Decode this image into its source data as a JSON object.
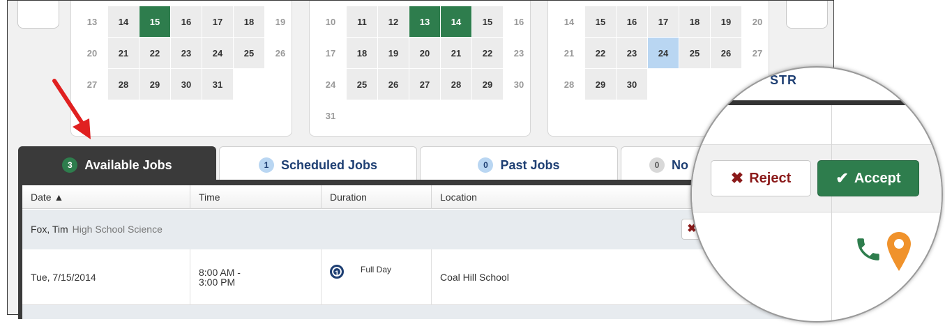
{
  "calendars": [
    {
      "rows": [
        [
          {
            "d": "13",
            "s": "muted"
          },
          {
            "d": "14",
            "s": "avail"
          },
          {
            "d": "15",
            "s": "job"
          },
          {
            "d": "16",
            "s": "avail"
          },
          {
            "d": "17",
            "s": "avail"
          },
          {
            "d": "18",
            "s": "avail"
          },
          {
            "d": "19",
            "s": "muted"
          }
        ],
        [
          {
            "d": "20",
            "s": "muted"
          },
          {
            "d": "21",
            "s": "avail"
          },
          {
            "d": "22",
            "s": "avail"
          },
          {
            "d": "23",
            "s": "avail"
          },
          {
            "d": "24",
            "s": "avail"
          },
          {
            "d": "25",
            "s": "avail"
          },
          {
            "d": "26",
            "s": "muted"
          }
        ],
        [
          {
            "d": "27",
            "s": "muted"
          },
          {
            "d": "28",
            "s": "avail"
          },
          {
            "d": "29",
            "s": "avail"
          },
          {
            "d": "30",
            "s": "avail"
          },
          {
            "d": "31",
            "s": "avail"
          }
        ]
      ]
    },
    {
      "rows": [
        [
          {
            "d": "10",
            "s": "muted"
          },
          {
            "d": "11",
            "s": "avail"
          },
          {
            "d": "12",
            "s": "avail"
          },
          {
            "d": "13",
            "s": "job"
          },
          {
            "d": "14",
            "s": "job"
          },
          {
            "d": "15",
            "s": "avail"
          },
          {
            "d": "16",
            "s": "muted"
          }
        ],
        [
          {
            "d": "17",
            "s": "muted"
          },
          {
            "d": "18",
            "s": "avail"
          },
          {
            "d": "19",
            "s": "avail"
          },
          {
            "d": "20",
            "s": "avail"
          },
          {
            "d": "21",
            "s": "avail"
          },
          {
            "d": "22",
            "s": "avail"
          },
          {
            "d": "23",
            "s": "muted"
          }
        ],
        [
          {
            "d": "24",
            "s": "muted"
          },
          {
            "d": "25",
            "s": "avail"
          },
          {
            "d": "26",
            "s": "avail"
          },
          {
            "d": "27",
            "s": "avail"
          },
          {
            "d": "28",
            "s": "avail"
          },
          {
            "d": "29",
            "s": "avail"
          },
          {
            "d": "30",
            "s": "muted"
          }
        ],
        [
          {
            "d": "31",
            "s": "muted"
          }
        ]
      ]
    },
    {
      "rows": [
        [
          {
            "d": "14",
            "s": "muted"
          },
          {
            "d": "15",
            "s": "avail"
          },
          {
            "d": "16",
            "s": "avail"
          },
          {
            "d": "17",
            "s": "avail"
          },
          {
            "d": "18",
            "s": "avail"
          },
          {
            "d": "19",
            "s": "avail"
          },
          {
            "d": "20",
            "s": "muted"
          }
        ],
        [
          {
            "d": "21",
            "s": "muted"
          },
          {
            "d": "22",
            "s": "avail"
          },
          {
            "d": "23",
            "s": "avail"
          },
          {
            "d": "24",
            "s": "today"
          },
          {
            "d": "25",
            "s": "avail"
          },
          {
            "d": "26",
            "s": "avail"
          },
          {
            "d": "27",
            "s": "muted"
          }
        ],
        [
          {
            "d": "28",
            "s": "muted"
          },
          {
            "d": "29",
            "s": "avail"
          },
          {
            "d": "30",
            "s": "avail"
          }
        ]
      ]
    }
  ],
  "tabs": {
    "available": {
      "count": "3",
      "label": "Available Jobs"
    },
    "scheduled": {
      "count": "1",
      "label": "Scheduled Jobs"
    },
    "past": {
      "count": "0",
      "label": "Past Jobs"
    },
    "fourth": {
      "count": "0",
      "label": "No"
    }
  },
  "table": {
    "headers": {
      "date": "Date ▲",
      "time": "Time",
      "duration": "Duration",
      "location": "Location"
    },
    "group": {
      "name": "Fox, Tim",
      "subject": "High School Science"
    },
    "row": {
      "date": "Tue, 7/15/2014",
      "time_start": "8:00 AM -",
      "time_end": "3:00 PM",
      "duration_icon": "1",
      "duration": "Full Day",
      "location": "Coal Hill School"
    }
  },
  "magnifier": {
    "title_fragment": "STR",
    "reject_label": "Reject",
    "accept_label": "Accept",
    "icons": [
      "x-icon",
      "check-icon",
      "phone-icon",
      "map-pin-icon"
    ]
  },
  "colors": {
    "green": "#2e7d4d",
    "dark": "#3a3a3a",
    "navy": "#1e3f73",
    "reject_red": "#8b1a1a",
    "pin_orange": "#f0922b",
    "today_blue": "#b9d6f2",
    "arrow_red": "#e02020"
  }
}
